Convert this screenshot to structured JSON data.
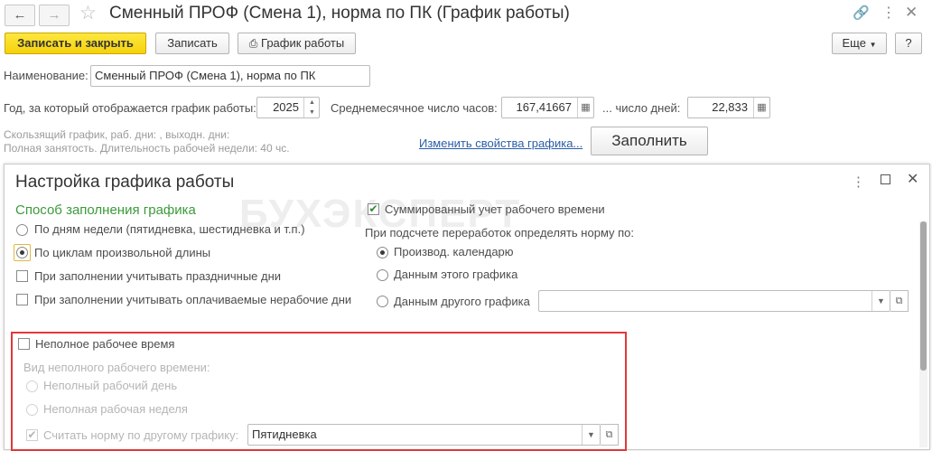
{
  "window": {
    "title": "Сменный ПРОФ (Смена 1), норма по ПК (График работы)",
    "back_icon": "arrow-left",
    "forward_icon": "arrow-right",
    "favorite_icon": "star",
    "link_icon": "link",
    "more_icon": "vertical-dots",
    "close_icon": "close"
  },
  "toolbar": {
    "save_close": "Записать и закрыть",
    "save": "Записать",
    "schedule": "График работы",
    "more": "Еще",
    "help": "?"
  },
  "form": {
    "name_label": "Наименование:",
    "name_value": "Сменный ПРОФ (Смена 1), норма по ПК",
    "year_label": "Год, за который отображается график работы:",
    "year_value": "2025",
    "avg_hours_label": "Среднемесячное число часов:",
    "avg_hours_value": "167,41667",
    "days_label": "... число дней:",
    "days_value": "22,833",
    "hint_line1": "Скользящий график, раб. дни: , выходн. дни:",
    "hint_line2": "Полная занятость. Длительность рабочей недели: 40 чс.",
    "change_link": "Изменить свойства графика...",
    "fill_button": "Заполнить"
  },
  "dialog": {
    "title": "Настройка графика работы",
    "watermark": "БУХЭКСПЕРТ",
    "fill_method_title": "Способ заполнения графика",
    "fill_options": [
      {
        "label": "По дням недели (пятидневка, шестидневка и т.п.)",
        "checked": false
      },
      {
        "label": "По циклам произвольной длины",
        "checked": true
      }
    ],
    "check_holidays": "При заполнении учитывать праздничные дни",
    "check_paid_nonwork": "При заполнении учитывать оплачиваемые нерабочие дни",
    "summarized_label": "Суммированный учет рабочего времени",
    "summarized_checked": true,
    "overtime_title": "При подсчете переработок определять норму по:",
    "overtime_options": [
      {
        "label": "Производ. календарю",
        "checked": true
      },
      {
        "label": "Данным этого графика",
        "checked": false
      },
      {
        "label": "Данным другого графика",
        "checked": false
      }
    ],
    "other_schedule_value": "",
    "part_time_label": "Неполное рабочее время",
    "part_time_type_label": "Вид неполного рабочего времени:",
    "part_time_options": [
      {
        "label": "Неполный рабочий день"
      },
      {
        "label": "Неполная рабочая неделя"
      }
    ],
    "norm_other_label": "Считать норму по другому графику:",
    "norm_other_value": "Пятидневка",
    "accent_color": "#3b9a3b",
    "highlight_color": "#e0393b"
  }
}
